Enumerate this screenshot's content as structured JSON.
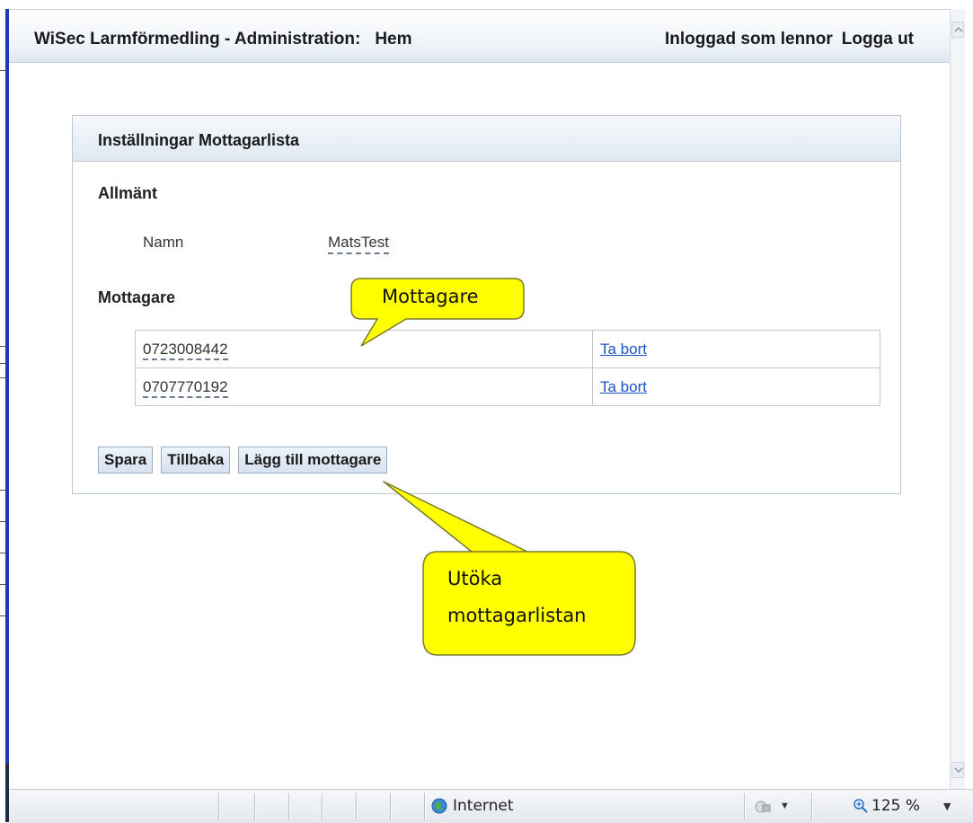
{
  "header": {
    "title": "WiSec Larmförmedling - Administration:",
    "home_link": "Hem",
    "logged_in_text": "Inloggad som lennor",
    "logout_link": "Logga ut"
  },
  "panel": {
    "title": "Inställningar Mottagarlista",
    "general_section": "Allmänt",
    "name_label": "Namn",
    "name_value": "MatsTest",
    "recipients_section": "Mottagare",
    "recipients": [
      {
        "number": "0723008442",
        "remove_label": "Ta bort"
      },
      {
        "number": "0707770192",
        "remove_label": "Ta bort"
      }
    ],
    "buttons": {
      "save": "Spara",
      "back": "Tillbaka",
      "add_recipient": "Lägg till mottagare"
    }
  },
  "callouts": {
    "recipients_callout": "Mottagare",
    "extend_callout_line1": "Utöka",
    "extend_callout_line2": "mottagarlistan",
    "fill_color": "#ffff00"
  },
  "statusbar": {
    "zone": "Internet",
    "zoom": "125 %"
  },
  "colors": {
    "link": "#1a53c7",
    "header_gradient_end": "#dde6f0",
    "button_border": "#99adc4"
  }
}
